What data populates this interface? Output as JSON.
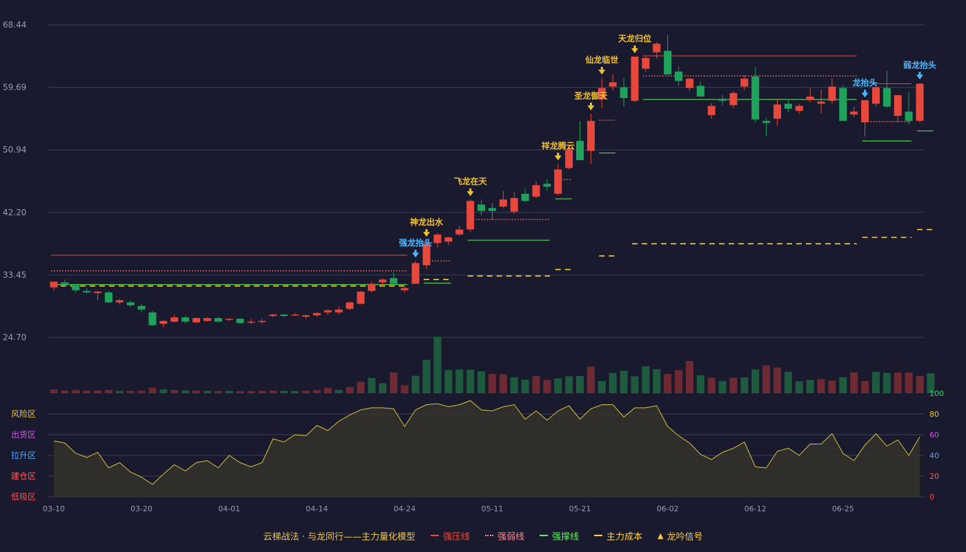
{
  "legend": {
    "title": "云梯战法 · 与龙同行——主力量化模型",
    "items": [
      {
        "label": "强压线",
        "color": "#ef4a3c",
        "style": "solid"
      },
      {
        "label": "强弱线",
        "color": "#ff8a8a",
        "style": "dotted"
      },
      {
        "label": "强撑线",
        "color": "#5cf25c",
        "style": "solid"
      },
      {
        "label": "主力成本",
        "color": "#ffd43b",
        "style": "dashed"
      },
      {
        "label": "龙吟信号",
        "color": "#ffc940",
        "style": "triangle",
        "icon": "triangle-icon"
      }
    ]
  },
  "colors": {
    "background": "#191a2e",
    "up": "#e8483b",
    "down": "#1fa35c",
    "grid": "#3a3d52",
    "signal_gold": "#f2c12e",
    "signal_blue": "#4db8ff",
    "oscillator": "#d8c43a"
  },
  "chart_data": [
    {
      "type": "candlestick",
      "x_tick_labels": [
        "03-10",
        "03-20",
        "04-01",
        "04-14",
        "04-24",
        "05-11",
        "05-21",
        "06-02",
        "06-12",
        "06-25"
      ],
      "x_tick_index": [
        0,
        8,
        16,
        24,
        32,
        40,
        48,
        56,
        64,
        72
      ],
      "y_tick_labels": [
        "68.44",
        "59.69",
        "50.94",
        "42.20",
        "33.45",
        "24.70"
      ],
      "ylim": [
        24.7,
        68.44
      ],
      "candles": [
        {
          "o": 31.7,
          "h": 32.3,
          "l": 31.2,
          "c": 32.5
        },
        {
          "o": 32.4,
          "h": 32.8,
          "l": 31.8,
          "c": 32.0
        },
        {
          "o": 32.0,
          "h": 32.2,
          "l": 31.0,
          "c": 31.3
        },
        {
          "o": 31.2,
          "h": 31.6,
          "l": 30.8,
          "c": 31.0
        },
        {
          "o": 30.9,
          "h": 31.2,
          "l": 29.9,
          "c": 31.1
        },
        {
          "o": 31.0,
          "h": 31.2,
          "l": 29.5,
          "c": 29.6
        },
        {
          "o": 29.6,
          "h": 30.1,
          "l": 29.3,
          "c": 29.9
        },
        {
          "o": 29.6,
          "h": 29.9,
          "l": 29.0,
          "c": 29.2
        },
        {
          "o": 29.1,
          "h": 29.4,
          "l": 28.2,
          "c": 28.6
        },
        {
          "o": 28.2,
          "h": 28.4,
          "l": 26.3,
          "c": 26.4
        },
        {
          "o": 26.6,
          "h": 27.1,
          "l": 26.1,
          "c": 27.0
        },
        {
          "o": 26.9,
          "h": 27.9,
          "l": 26.8,
          "c": 27.5
        },
        {
          "o": 27.5,
          "h": 27.7,
          "l": 26.7,
          "c": 26.9
        },
        {
          "o": 26.8,
          "h": 27.5,
          "l": 26.7,
          "c": 27.4
        },
        {
          "o": 27.0,
          "h": 27.5,
          "l": 26.9,
          "c": 27.4
        },
        {
          "o": 27.4,
          "h": 27.6,
          "l": 26.8,
          "c": 26.9
        },
        {
          "o": 27.2,
          "h": 27.4,
          "l": 27.0,
          "c": 27.3
        },
        {
          "o": 27.3,
          "h": 27.4,
          "l": 26.6,
          "c": 26.7
        },
        {
          "o": 26.9,
          "h": 27.3,
          "l": 26.6,
          "c": 26.9
        },
        {
          "o": 26.9,
          "h": 27.3,
          "l": 26.6,
          "c": 27.0
        },
        {
          "o": 27.7,
          "h": 28.0,
          "l": 27.5,
          "c": 27.9
        },
        {
          "o": 27.9,
          "h": 28.0,
          "l": 27.5,
          "c": 27.7
        },
        {
          "o": 27.8,
          "h": 28.1,
          "l": 27.7,
          "c": 27.9
        },
        {
          "o": 27.6,
          "h": 27.9,
          "l": 27.3,
          "c": 27.8
        },
        {
          "o": 27.8,
          "h": 28.3,
          "l": 27.6,
          "c": 28.1
        },
        {
          "o": 28.2,
          "h": 28.6,
          "l": 27.8,
          "c": 28.5
        },
        {
          "o": 28.2,
          "h": 29.1,
          "l": 27.9,
          "c": 28.6
        },
        {
          "o": 28.7,
          "h": 29.7,
          "l": 28.5,
          "c": 29.6
        },
        {
          "o": 29.4,
          "h": 31.2,
          "l": 29.3,
          "c": 31.1
        },
        {
          "o": 31.2,
          "h": 32.5,
          "l": 31.0,
          "c": 32.2
        },
        {
          "o": 32.4,
          "h": 33.0,
          "l": 31.9,
          "c": 32.8
        },
        {
          "o": 33.0,
          "h": 33.8,
          "l": 32.1,
          "c": 32.2
        },
        {
          "o": 31.3,
          "h": 31.8,
          "l": 31.0,
          "c": 31.6
        },
        {
          "o": 32.2,
          "h": 35.4,
          "l": 32.2,
          "c": 35.1
        },
        {
          "o": 34.8,
          "h": 38.3,
          "l": 34.2,
          "c": 37.8
        },
        {
          "o": 37.9,
          "h": 39.3,
          "l": 37.3,
          "c": 39.1
        },
        {
          "o": 38.1,
          "h": 38.8,
          "l": 37.6,
          "c": 38.7
        },
        {
          "o": 39.1,
          "h": 40.3,
          "l": 38.9,
          "c": 39.8
        },
        {
          "o": 39.8,
          "h": 44.0,
          "l": 39.5,
          "c": 43.8
        },
        {
          "o": 43.3,
          "h": 44.0,
          "l": 41.8,
          "c": 42.4
        },
        {
          "o": 42.8,
          "h": 43.5,
          "l": 41.2,
          "c": 42.4
        },
        {
          "o": 43.0,
          "h": 45.2,
          "l": 42.8,
          "c": 44.0
        },
        {
          "o": 42.3,
          "h": 45.0,
          "l": 42.0,
          "c": 44.2
        },
        {
          "o": 44.8,
          "h": 45.6,
          "l": 43.6,
          "c": 43.8
        },
        {
          "o": 44.4,
          "h": 46.5,
          "l": 44.2,
          "c": 46.0
        },
        {
          "o": 46.2,
          "h": 46.8,
          "l": 45.2,
          "c": 45.8
        },
        {
          "o": 44.8,
          "h": 49.0,
          "l": 44.6,
          "c": 48.2
        },
        {
          "o": 48.4,
          "h": 51.5,
          "l": 48.2,
          "c": 51.0
        },
        {
          "o": 52.2,
          "h": 55.0,
          "l": 49.5,
          "c": 49.5
        },
        {
          "o": 50.8,
          "h": 56.0,
          "l": 49.0,
          "c": 55.0
        },
        {
          "o": 58.0,
          "h": 61.0,
          "l": 56.8,
          "c": 59.6
        },
        {
          "o": 59.8,
          "h": 61.5,
          "l": 59.2,
          "c": 60.4
        },
        {
          "o": 59.7,
          "h": 61.0,
          "l": 57.0,
          "c": 58.2
        },
        {
          "o": 57.8,
          "h": 64.0,
          "l": 57.6,
          "c": 64.0
        },
        {
          "o": 62.3,
          "h": 64.0,
          "l": 61.9,
          "c": 63.8
        },
        {
          "o": 64.6,
          "h": 66.0,
          "l": 63.7,
          "c": 65.8
        },
        {
          "o": 64.8,
          "h": 67.0,
          "l": 61.5,
          "c": 61.5
        },
        {
          "o": 61.9,
          "h": 62.6,
          "l": 59.9,
          "c": 60.6
        },
        {
          "o": 59.6,
          "h": 61.0,
          "l": 59.2,
          "c": 60.9
        },
        {
          "o": 59.9,
          "h": 60.5,
          "l": 58.4,
          "c": 58.4
        },
        {
          "o": 55.8,
          "h": 57.5,
          "l": 55.3,
          "c": 57.1
        },
        {
          "o": 58.1,
          "h": 58.6,
          "l": 57.2,
          "c": 57.8
        },
        {
          "o": 57.2,
          "h": 59.2,
          "l": 56.8,
          "c": 58.9
        },
        {
          "o": 59.8,
          "h": 61.4,
          "l": 59.3,
          "c": 60.9
        },
        {
          "o": 61.2,
          "h": 62.5,
          "l": 54.8,
          "c": 55.2
        },
        {
          "o": 55.0,
          "h": 55.4,
          "l": 52.8,
          "c": 54.7
        },
        {
          "o": 55.3,
          "h": 58.0,
          "l": 54.3,
          "c": 57.3
        },
        {
          "o": 57.4,
          "h": 57.9,
          "l": 56.2,
          "c": 56.7
        },
        {
          "o": 56.4,
          "h": 57.4,
          "l": 56.0,
          "c": 57.1
        },
        {
          "o": 57.9,
          "h": 59.6,
          "l": 57.6,
          "c": 58.4
        },
        {
          "o": 57.4,
          "h": 59.4,
          "l": 56.0,
          "c": 57.7
        },
        {
          "o": 57.8,
          "h": 61.0,
          "l": 57.4,
          "c": 59.8
        },
        {
          "o": 59.6,
          "h": 60.0,
          "l": 55.0,
          "c": 55.0
        },
        {
          "o": 55.9,
          "h": 57.0,
          "l": 55.5,
          "c": 56.3
        },
        {
          "o": 54.8,
          "h": 57.8,
          "l": 52.8,
          "c": 57.9
        },
        {
          "o": 57.4,
          "h": 59.8,
          "l": 57.0,
          "c": 59.7
        },
        {
          "o": 59.6,
          "h": 62.0,
          "l": 56.8,
          "c": 57.0
        },
        {
          "o": 55.7,
          "h": 58.4,
          "l": 54.8,
          "c": 58.6
        },
        {
          "o": 56.3,
          "h": 59.0,
          "l": 54.5,
          "c": 55.0
        },
        {
          "o": 55.0,
          "h": 60.3,
          "l": 54.8,
          "c": 60.2
        }
      ],
      "volume": [
        2.0,
        1.5,
        1.7,
        1.4,
        1.6,
        1.8,
        1.2,
        1.3,
        1.4,
        3.0,
        2.1,
        1.8,
        1.5,
        1.4,
        1.3,
        1.2,
        1.3,
        1.1,
        1.2,
        1.3,
        1.4,
        1.3,
        1.2,
        1.3,
        1.7,
        2.8,
        1.8,
        3.4,
        6.2,
        8.2,
        5.4,
        11.2,
        4.3,
        9.4,
        17.9,
        30.3,
        12.5,
        12.8,
        12.6,
        11.8,
        10.4,
        10.1,
        8.6,
        7.3,
        9.2,
        7.2,
        8.0,
        9.1,
        9.3,
        14.3,
        6.6,
        10.9,
        12.1,
        9.1,
        14.5,
        12.9,
        10.4,
        12.4,
        17.3,
        9.7,
        8.4,
        6.5,
        8.3,
        8.5,
        12.7,
        14.9,
        13.8,
        11.5,
        6.4,
        7.2,
        7.6,
        6.8,
        8.6,
        11.2,
        6.6,
        11.5,
        10.9,
        11.1,
        11.1,
        9.3,
        10.7
      ],
      "volume_up": [
        true,
        true,
        true,
        true,
        true,
        true,
        false,
        true,
        true,
        true,
        false,
        true,
        false,
        true,
        false,
        true,
        false,
        true,
        true,
        true,
        true,
        false,
        false,
        true,
        true,
        true,
        false,
        true,
        true,
        false,
        false,
        true,
        true,
        false,
        false,
        false,
        false,
        false,
        false,
        false,
        true,
        true,
        false,
        false,
        true,
        true,
        false,
        false,
        false,
        true,
        false,
        false,
        false,
        false,
        false,
        false,
        true,
        true,
        true,
        false,
        true,
        false,
        true,
        false,
        false,
        true,
        true,
        false,
        false,
        false,
        true,
        true,
        false,
        true,
        true,
        false,
        false,
        true,
        true,
        true,
        false
      ],
      "signals": [
        {
          "idx": 33,
          "label": "强龙抬头",
          "color": "#4db8ff"
        },
        {
          "idx": 34,
          "label": "神龙出水",
          "color": "#f2c12e"
        },
        {
          "idx": 38,
          "label": "飞龙在天",
          "color": "#f2c12e"
        },
        {
          "idx": 46,
          "label": "祥龙腾云",
          "color": "#f2c12e"
        },
        {
          "idx": 49,
          "label": "圣龙御天",
          "color": "#f2c12e"
        },
        {
          "idx": 50,
          "label": "仙龙临世",
          "color": "#f2c12e"
        },
        {
          "idx": 53,
          "label": "天龙归位",
          "color": "#f2c12e"
        },
        {
          "idx": 74,
          "label": "龙抬头",
          "color": "#4db8ff"
        },
        {
          "idx": 79,
          "label": "弱龙抬头",
          "color": "#4db8ff"
        }
      ],
      "lines": {
        "pressure": [
          {
            "from": 0,
            "to": 32,
            "v": 36.2
          },
          {
            "from": 54,
            "to": 73,
            "v": 64.1
          },
          {
            "from": 75,
            "to": 78,
            "v": 60.2
          }
        ],
        "strength": [
          {
            "from": 0,
            "to": 32,
            "v": 34.0
          },
          {
            "from": 34,
            "to": 36,
            "v": 35.4
          },
          {
            "from": 38,
            "to": 45,
            "v": 41.2
          },
          {
            "from": 46,
            "to": 47,
            "v": 46.8
          },
          {
            "from": 50,
            "to": 51,
            "v": 55.1
          },
          {
            "from": 54,
            "to": 73,
            "v": 61.3
          },
          {
            "from": 74,
            "to": 78,
            "v": 54.9
          }
        ],
        "support": [
          {
            "from": 0,
            "to": 32,
            "v": 32.1
          },
          {
            "from": 34,
            "to": 36,
            "v": 32.3
          },
          {
            "from": 38,
            "to": 45,
            "v": 38.3
          },
          {
            "from": 46,
            "to": 47,
            "v": 44.1
          },
          {
            "from": 50,
            "to": 51,
            "v": 50.5
          },
          {
            "from": 54,
            "to": 73,
            "v": 58.0
          },
          {
            "from": 74,
            "to": 78,
            "v": 52.2
          },
          {
            "from": 79,
            "to": 80,
            "v": 53.6
          }
        ],
        "cost": [
          {
            "from": 0,
            "to": 32,
            "v": 31.9
          },
          {
            "from": 34,
            "to": 36,
            "v": 32.8
          },
          {
            "from": 38,
            "to": 45,
            "v": 33.3
          },
          {
            "from": 46,
            "to": 47,
            "v": 34.2
          },
          {
            "from": 50,
            "to": 51,
            "v": 36.1
          },
          {
            "from": 53,
            "to": 73,
            "v": 37.8
          },
          {
            "from": 74,
            "to": 78,
            "v": 38.7
          },
          {
            "from": 79,
            "to": 80,
            "v": 39.8
          }
        ]
      }
    },
    {
      "type": "line",
      "zone_labels": [
        {
          "label": "风险区",
          "color": "#f2c12e"
        },
        {
          "label": "出货区",
          "color": "#d94ff0"
        },
        {
          "label": "拉升区",
          "color": "#4da6ff"
        },
        {
          "label": "建仓区",
          "color": "#ff5a5a"
        },
        {
          "label": "低吸区",
          "color": "#ff4a4a"
        }
      ],
      "y_tick_labels": [
        {
          "label": "100",
          "color": "#3fd06a"
        },
        {
          "label": "80",
          "color": "#f2c12e"
        },
        {
          "label": "60",
          "color": "#d94ff0"
        },
        {
          "label": "40",
          "color": "#4da6ff"
        },
        {
          "label": "20",
          "color": "#ff5a5a"
        },
        {
          "label": "0",
          "color": "#ff4a4a"
        }
      ],
      "ylim": [
        0,
        100
      ],
      "values": [
        54,
        52,
        42,
        38,
        43,
        28,
        33,
        24,
        19,
        12,
        22,
        31,
        25,
        33,
        35,
        28,
        40,
        33,
        29,
        33,
        56,
        53,
        60,
        59,
        69,
        64,
        73,
        79,
        84,
        86,
        86,
        85,
        68,
        84,
        89,
        90,
        87,
        89,
        93,
        84,
        83,
        87,
        89,
        75,
        83,
        74,
        83,
        88,
        75,
        85,
        89,
        89,
        77,
        86,
        86,
        88,
        68,
        59,
        52,
        41,
        36,
        43,
        47,
        53,
        29,
        28,
        44,
        47,
        40,
        51,
        51,
        61,
        42,
        35,
        50,
        61,
        49,
        55,
        40,
        58
      ]
    }
  ]
}
